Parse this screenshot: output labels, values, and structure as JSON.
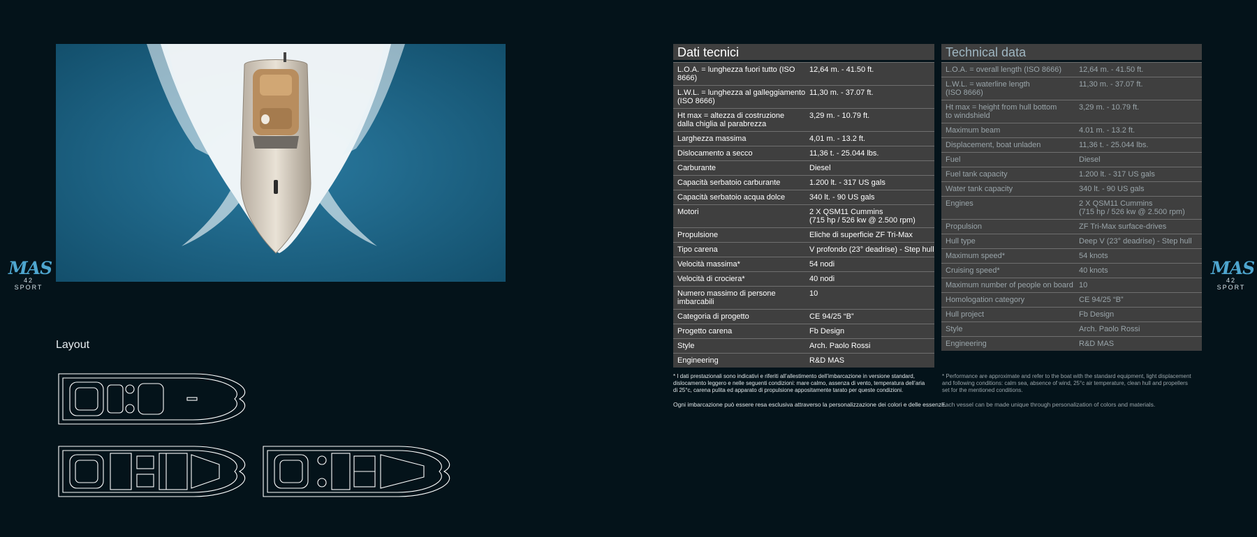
{
  "brand": {
    "logo_text": "MAS",
    "model": "42 SPORT"
  },
  "layout_section": {
    "title": "Layout"
  },
  "specs_it": {
    "title": "Dati tecnici",
    "rows": [
      {
        "label": "L.O.A. = lunghezza fuori tutto (ISO 8666)",
        "value": "12,64 m. - 41.50 ft."
      },
      {
        "label": "L.W.L. = lunghezza al galleggiamento\n(ISO 8666)",
        "value": "11,30 m. - 37.07 ft."
      },
      {
        "label": "Ht max = altezza di costruzione\ndalla chiglia al parabrezza",
        "value": "3,29 m. - 10.79 ft."
      },
      {
        "label": "Larghezza massima",
        "value": "4,01 m. - 13.2 ft."
      },
      {
        "label": "Dislocamento a secco",
        "value": "11,36 t. - 25.044 lbs."
      },
      {
        "label": "Carburante",
        "value": "Diesel"
      },
      {
        "label": "Capacità serbatoio carburante",
        "value": "1.200 lt. - 317 US gals"
      },
      {
        "label": "Capacità serbatoio acqua dolce",
        "value": "340 lt. - 90 US gals"
      },
      {
        "label": "Motori",
        "value": "2 X QSM11 Cummins\n(715 hp / 526 kw @ 2.500 rpm)"
      },
      {
        "label": "Propulsione",
        "value": "Eliche di superficie ZF Tri-Max"
      },
      {
        "label": "Tipo carena",
        "value": "V profondo (23° deadrise) - Step hull"
      },
      {
        "label": "Velocità massima*",
        "value": "54 nodi"
      },
      {
        "label": "Velocità di crociera*",
        "value": "40 nodi"
      },
      {
        "label": "Numero massimo di persone imbarcabili",
        "value": "10"
      },
      {
        "label": "Categoria di progetto",
        "value": "CE 94/25 “B”"
      },
      {
        "label": "Progetto carena",
        "value": "Fb Design"
      },
      {
        "label": "Style",
        "value": "Arch. Paolo Rossi"
      },
      {
        "label": "Engineering",
        "value": "R&D MAS"
      }
    ],
    "note": "* I dati prestazionali sono indicativi e riferiti all’allestimento dell’imbarcazione in versione standard,\n   dislocamento leggero e nelle seguenti condizioni: mare calmo, assenza di vento, temperatura dell’aria\n   di 25°c, carena pulita ed apparato di propulsione appositamente tarato per queste condizioni.",
    "tagline": "Ogni imbarcazione può essere resa esclusiva attraverso la personalizzazione dei colori e delle essenze."
  },
  "specs_en": {
    "title": "Technical data",
    "rows": [
      {
        "label": "L.O.A. = overall length (ISO 8666)",
        "value": "12,64 m. - 41.50 ft."
      },
      {
        "label": "L.W.L. = waterline length\n(ISO 8666)",
        "value": "11,30 m. - 37.07 ft."
      },
      {
        "label": "Ht max = height from hull bottom\nto windshield",
        "value": "3,29 m. - 10.79 ft."
      },
      {
        "label": "Maximum beam",
        "value": "4.01 m. - 13.2 ft."
      },
      {
        "label": "Displacement, boat unladen",
        "value": "11,36 t. - 25.044 lbs."
      },
      {
        "label": "Fuel",
        "value": "Diesel"
      },
      {
        "label": "Fuel tank capacity",
        "value": "1.200 lt. - 317 US gals"
      },
      {
        "label": "Water tank capacity",
        "value": "340 lt. - 90 US gals"
      },
      {
        "label": "Engines",
        "value": "2 X QSM11 Cummins\n(715 hp / 526 kw @ 2.500 rpm)"
      },
      {
        "label": "Propulsion",
        "value": "ZF Tri-Max surface-drives"
      },
      {
        "label": "Hull type",
        "value": "Deep V (23° deadrise) - Step hull"
      },
      {
        "label": "Maximum speed*",
        "value": "54 knots"
      },
      {
        "label": "Cruising speed*",
        "value": "40 knots"
      },
      {
        "label": "Maximum number of people on board",
        "value": "10"
      },
      {
        "label": "Homologation category",
        "value": "CE 94/25 “B”"
      },
      {
        "label": "Hull project",
        "value": "Fb Design"
      },
      {
        "label": "Style",
        "value": "Arch. Paolo Rossi"
      },
      {
        "label": "Engineering",
        "value": "R&D MAS"
      }
    ],
    "note": "* Performance are approximate and refer to the boat with the standard equipment, light displacement\n   and following conditions: calm sea, absence of wind, 25°c air temperature, clean hull and propellers\n   set for the mentioned conditions.",
    "tagline": "Each vessel can be made unique through personalization of colors and materials."
  },
  "colors": {
    "background": "#04131a",
    "table_bg": "#3f3f3f",
    "accent": "#4ea6cf",
    "sea": "#1f6a8c"
  }
}
